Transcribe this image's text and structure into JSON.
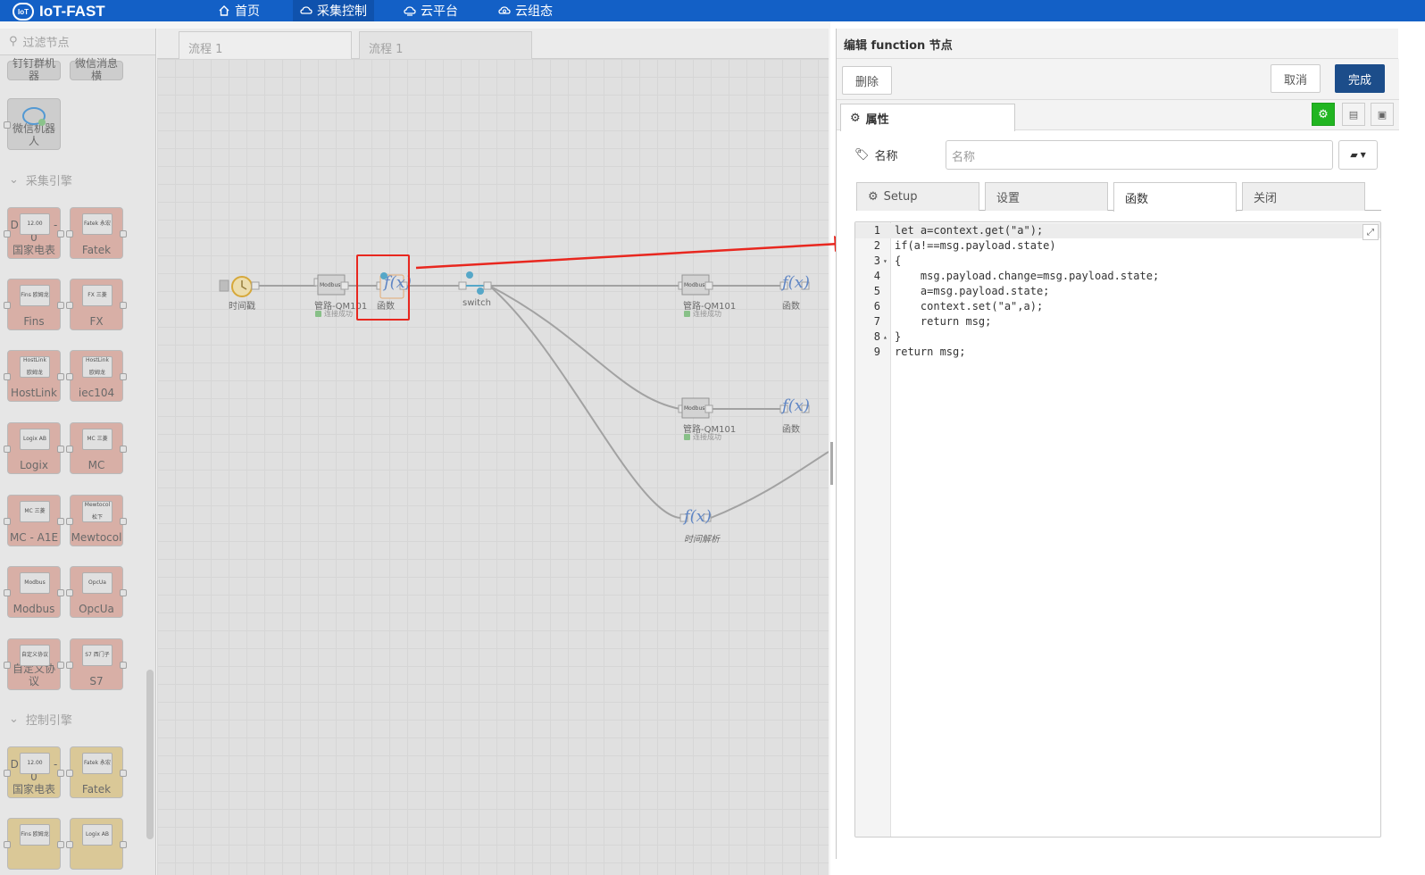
{
  "app": {
    "title": "IoT-FAST",
    "logo_text": "IoT"
  },
  "nav": [
    {
      "label": "首页"
    },
    {
      "label": "采集控制"
    },
    {
      "label": "云平台"
    },
    {
      "label": "云组态"
    }
  ],
  "palette": {
    "filter_placeholder": "过滤节点",
    "partial_nodes": [
      "钉钉群机器",
      "微信消息横"
    ],
    "wechat_bot": "微信机器人",
    "categories": {
      "collect": "采集引擎",
      "control": "控制引擎"
    },
    "collect_nodes": [
      {
        "label": "DLT645 - 0\n国家电表",
        "mini": "12.00"
      },
      {
        "label": "Fatek",
        "mini": "Fatek 永宏"
      },
      {
        "label": "Fins",
        "mini": "Fins 欧姆龙"
      },
      {
        "label": "FX",
        "mini": "FX 三菱"
      },
      {
        "label": "HostLink",
        "mini": "HostLink 欧姆龙"
      },
      {
        "label": "iec104",
        "mini": "HostLink 欧姆龙"
      },
      {
        "label": "Logix",
        "mini": "Logix AB"
      },
      {
        "label": "MC",
        "mini": "MC 三菱"
      },
      {
        "label": "MC - A1E",
        "mini": "MC 三菱"
      },
      {
        "label": "Mewtocol",
        "mini": "Mewtocol 松下"
      },
      {
        "label": "Modbus",
        "mini": "Modbus"
      },
      {
        "label": "OpcUa",
        "mini": "OpcUa"
      },
      {
        "label": "自定义协议",
        "mini": "自定义协议"
      },
      {
        "label": "S7",
        "mini": "S7 西门子"
      }
    ],
    "control_nodes": [
      {
        "label": "DLT645 - 0\n国家电表",
        "mini": "12.00"
      },
      {
        "label": "Fatek",
        "mini": "Fatek 永宏"
      },
      {
        "label": "",
        "mini": "Fins 欧姆龙"
      },
      {
        "label": "",
        "mini": "Logix AB"
      }
    ]
  },
  "tabs": [
    {
      "label": "流程 1"
    },
    {
      "label": "流程 1"
    }
  ],
  "flow": {
    "nodes": [
      {
        "label": "时间戳"
      },
      {
        "label": "管路-QM101",
        "status": "连接成功",
        "mini": "Modbus"
      },
      {
        "label": "函数"
      },
      {
        "label": "switch"
      },
      {
        "label": "管路-QM101",
        "status": "连接成功",
        "mini": "Modbus"
      },
      {
        "label": "函数"
      },
      {
        "label": "管路-QM101",
        "status": "连接成功",
        "mini": "Modbus"
      },
      {
        "label": "函数"
      },
      {
        "label": "时间解析"
      }
    ]
  },
  "editor": {
    "title": "编辑 function 节点",
    "delete_label": "删除",
    "cancel_label": "取消",
    "done_label": "完成",
    "properties_tab": "属性",
    "name_label": "名称",
    "name_placeholder": "名称",
    "subtabs": [
      "Setup",
      "设置",
      "函数",
      "关闭"
    ],
    "code_lines": [
      "let a=context.get(\"a\");",
      "if(a!==msg.payload.state)",
      "{",
      "    msg.payload.change=msg.payload.state;",
      "    a=msg.payload.state;",
      "    context.set(\"a\",a);",
      "    return msg;",
      "}",
      "return msg;"
    ],
    "line_numbers": [
      "1",
      "2",
      "3",
      "4",
      "5",
      "6",
      "7",
      "8",
      "9"
    ]
  },
  "colors": {
    "topbar": "#1360c6",
    "primary_button": "#1c4d8a",
    "highlight": "#e8271f",
    "green_button": "#21b521"
  }
}
